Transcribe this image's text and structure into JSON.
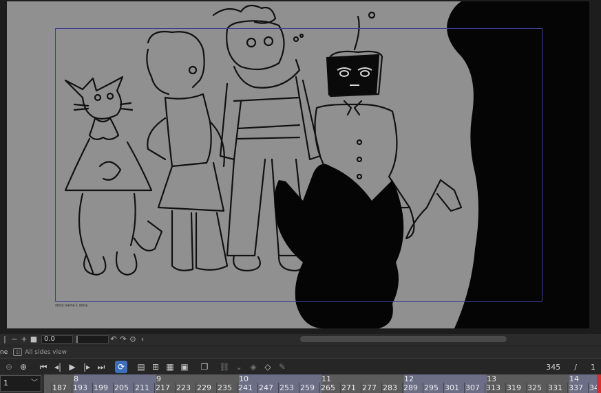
{
  "canvas": {
    "background": "#909090",
    "story_caption": "story name 1 story",
    "frame_guide_color": "#3b3f8f"
  },
  "view_toolbar": {
    "zoom_out": "−",
    "zoom_in": "+",
    "zoom_value": "0.0",
    "rotate_left": "↶",
    "rotate_right": "↷"
  },
  "tabs": [
    {
      "label": "ne",
      "icon": "panel-icon"
    },
    {
      "label": "All sides view",
      "icon": "all-sides-view-icon"
    }
  ],
  "timeline_toolbar": {
    "icons": [
      "zoom-out-icon",
      "zoom-in-icon",
      "first-frame-icon",
      "previous-frame-icon",
      "play-icon",
      "next-frame-icon",
      "last-frame-icon",
      "loop-icon",
      "new-animation-folder-icon",
      "new-cel-icon",
      "specify-cels-icon",
      "register-cel-icon",
      "onion-skin-icon",
      "link-icon",
      "camera-icon",
      "edit-keyframe-icon",
      "pen-icon"
    ],
    "current_frame": "345",
    "separator": "/",
    "total_value": "1"
  },
  "ruler": {
    "track_select_value": "1",
    "seconds": [
      {
        "label": "8"
      },
      {
        "label": "9"
      },
      {
        "label": "10"
      },
      {
        "label": "11"
      },
      {
        "label": "12"
      },
      {
        "label": "13"
      },
      {
        "label": "14"
      }
    ],
    "frames": [
      "187",
      "193",
      "199",
      "205",
      "211",
      "217",
      "223",
      "229",
      "235",
      "241",
      "247",
      "253",
      "259",
      "265",
      "271",
      "277",
      "283",
      "289",
      "295",
      "301",
      "307",
      "313",
      "319",
      "325",
      "331",
      "337",
      "34"
    ],
    "block_color": "#6c6e86",
    "playhead_color": "#d0312d"
  }
}
